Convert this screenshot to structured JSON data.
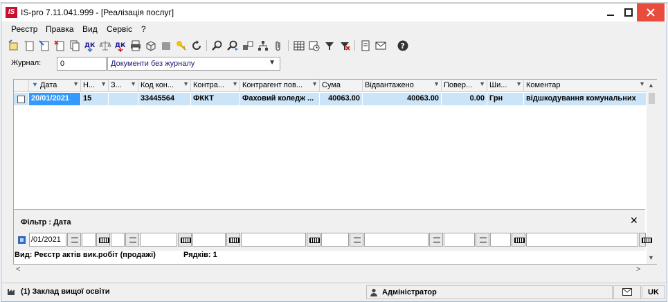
{
  "window": {
    "title": "IS-pro 7.11.041.999 - [Реалізація послуг]",
    "logo_text": "IS"
  },
  "menu": [
    "Реєстр",
    "Правка",
    "Вид",
    "Сервіс",
    "?"
  ],
  "journal": {
    "label": "Журнал:",
    "number": "0",
    "name": "Документи без журналу"
  },
  "grid": {
    "columns": [
      "Дата",
      "Н...",
      "З...",
      "Код кон...",
      "Контра...",
      "Контрагент пов...",
      "Сума",
      "Відвантажено",
      "Повер...",
      "Ши...",
      "Коментар"
    ],
    "rows": [
      {
        "date": "20/01/2021",
        "number": "15",
        "z": "",
        "code": "33445564",
        "contractor": "ФККТ",
        "contractor_full": "Фаховий коледж ...",
        "sum": "40063.00",
        "shipped": "40063.00",
        "returned": "0.00",
        "currency": "Грн",
        "comment": "відшкодування комунальних"
      }
    ]
  },
  "filter": {
    "title": "Фільтр : Дата",
    "date_value": "/01/2021"
  },
  "info": {
    "view": "Вид: Реєстр актів вик.робіт (продажі)",
    "rows": "Рядків: 1"
  },
  "status": {
    "org": "(1) Заклад вищої освіти",
    "user": "Адміністратор",
    "lang": "UK"
  }
}
